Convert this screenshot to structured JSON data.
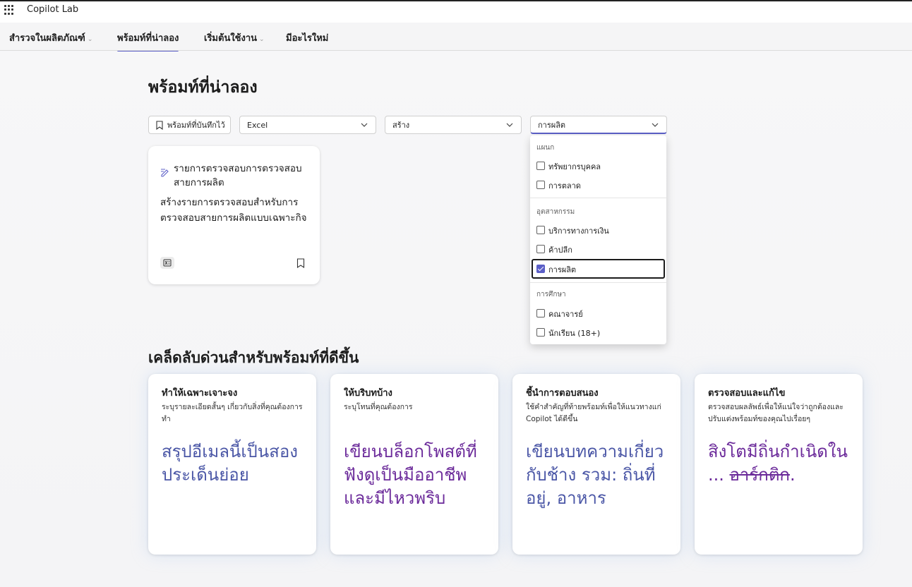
{
  "app": {
    "title": "Copilot Lab"
  },
  "nav": [
    {
      "label": "สำรวจในผลิตภัณฑ์",
      "has_chevron": true,
      "active": false
    },
    {
      "label": "พร้อมท์ที่น่าลอง",
      "has_chevron": false,
      "active": true
    },
    {
      "label": "เริ่มต้นใช้งาน",
      "has_chevron": true,
      "active": false
    },
    {
      "label": "มีอะไรใหม่",
      "has_chevron": false,
      "active": false
    }
  ],
  "page": {
    "title": "พร้อมท์ที่น่าลอง"
  },
  "filters": {
    "saved_label": "พร้อมท์ที่บันทึกไว้",
    "app_value": "Excel",
    "action_value": "สร้าง",
    "category_value": "การผลิต"
  },
  "prompt_card": {
    "title": "รายการตรวจสอบการตรวจสอบสายการผลิต",
    "description": "สร้างรายการตรวจสอบสำหรับการตรวจสอบสายการผลิตแบบเฉพาะกิจ",
    "app_icon": "excel-icon"
  },
  "menu": {
    "groups": [
      {
        "label": "แผนก",
        "options": [
          {
            "label": "ทรัพยากรบุคคล",
            "checked": false
          },
          {
            "label": "การตลาด",
            "checked": false
          }
        ]
      },
      {
        "label": "อุตสาหกรรม",
        "options": [
          {
            "label": "บริการทางการเงิน",
            "checked": false
          },
          {
            "label": "ค้าปลีก",
            "checked": false
          },
          {
            "label": "การผลิต",
            "checked": true
          }
        ]
      },
      {
        "label": "การศึกษา",
        "options": [
          {
            "label": "คณาจารย์",
            "checked": false
          },
          {
            "label": "นักเรียน (18+)",
            "checked": false
          }
        ]
      }
    ]
  },
  "tips": {
    "title": "เคล็ดลับด่วนสำหรับพร้อมท์ที่ดีขึ้น",
    "cards": [
      {
        "heading": "ทำให้เฉพาะเจาะจง",
        "subtitle": "ระบุรายละเอียดสั้นๆ เกี่ยวกับสิ่งที่คุณต้องการทำ",
        "example": "สรุปอีเมลนี้เป็นสองประเด็นย่อย",
        "example_color": "#4a56a6"
      },
      {
        "heading": "ให้บริบทบ้าง",
        "subtitle": "ระบุโทนที่คุณต้องการ",
        "example": "เขียนบล็อกโพสต์ที่ฟังดูเป็นมืออาชีพและมีไหวพริบ",
        "example_color": "#6b2a9a"
      },
      {
        "heading": "ชี้นำการตอบสนอง",
        "subtitle": "ใช้คำสำคัญที่ท้ายพร้อมท์เพื่อให้แนวทางแก่ Copilot ได้ดีขึ้น",
        "example": "เขียนบทความเกี่ยวกับช้าง รวม: ถิ่นที่อยู่, อาหาร",
        "example_color": "#4a56a6"
      },
      {
        "heading": "ตรวจสอบและแก้ไข",
        "subtitle": "ตรวจสอบผลลัพธ์เพื่อให้แน่ใจว่าถูกต้องและปรับแต่งพร้อมท์ของคุณไปเรื่อยๆ",
        "example_prefix": "สิงโตมีถิ่นกำเนิดใน ... ",
        "example_struck": "อาร์กติก",
        "example_suffix": ".",
        "example_color": "#6b2a9a"
      }
    ]
  }
}
